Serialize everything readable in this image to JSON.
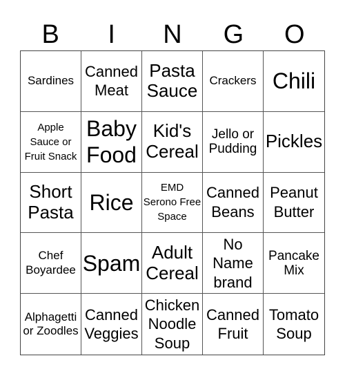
{
  "header": [
    "B",
    "I",
    "N",
    "G",
    "O"
  ],
  "cells": [
    {
      "text": "Sardines",
      "size": "s-xs"
    },
    {
      "text": "Canned Meat",
      "size": "s-m"
    },
    {
      "text": "Pasta Sauce",
      "size": "s-l"
    },
    {
      "text": "Crackers",
      "size": "s-xs"
    },
    {
      "text": "Chili",
      "size": "s-xl"
    },
    {
      "text": "Apple Sauce or Fruit Snack",
      "size": "s-xxs"
    },
    {
      "text": "Baby Food",
      "size": "s-xl"
    },
    {
      "text": "Kid's Cereal",
      "size": "s-l"
    },
    {
      "text": "Jello or Pudding",
      "size": "s-s"
    },
    {
      "text": "Pickles",
      "size": "s-l"
    },
    {
      "text": "Short Pasta",
      "size": "s-l"
    },
    {
      "text": "Rice",
      "size": "s-xl"
    },
    {
      "text": "EMD Serono Free Space",
      "size": "s-xxs"
    },
    {
      "text": "Canned Beans",
      "size": "s-m"
    },
    {
      "text": "Peanut Butter",
      "size": "s-m"
    },
    {
      "text": "Chef Boyardee",
      "size": "s-xs"
    },
    {
      "text": "Spam",
      "size": "s-xl"
    },
    {
      "text": "Adult Cereal",
      "size": "s-l"
    },
    {
      "text": "No Name brand",
      "size": "s-m"
    },
    {
      "text": "Pancake Mix",
      "size": "s-s"
    },
    {
      "text": "Alphagetti or Zoodles",
      "size": "s-xs"
    },
    {
      "text": "Canned Veggies",
      "size": "s-m"
    },
    {
      "text": "Chicken Noodle Soup",
      "size": "s-m"
    },
    {
      "text": "Canned Fruit",
      "size": "s-m"
    },
    {
      "text": "Tomato Soup",
      "size": "s-m"
    }
  ]
}
